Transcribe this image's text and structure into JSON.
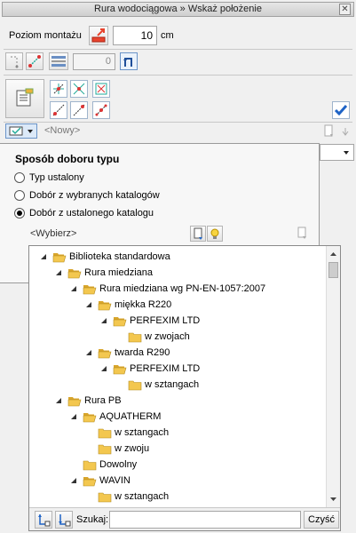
{
  "window": {
    "title": "Rura wodociągowa » Wskaż położenie"
  },
  "mount": {
    "label": "Poziom montażu",
    "value": "10",
    "unit": "cm"
  },
  "row2": {
    "counter": "0"
  },
  "type_row": {
    "placeholder": "<Nowy>"
  },
  "panel": {
    "title": "Sposób doboru typu",
    "options": [
      {
        "label": "Typ ustalony",
        "selected": false
      },
      {
        "label": "Dobór z wybranych katalogów",
        "selected": false
      },
      {
        "label": "Dobór z ustalonego katalogu",
        "selected": true
      }
    ],
    "catalog_select": "<Wybierz>"
  },
  "tree": {
    "items": [
      {
        "label": "Biblioteka standardowa",
        "level": 0,
        "expanded": true
      },
      {
        "label": "Rura miedziana",
        "level": 1,
        "expanded": true
      },
      {
        "label": "Rura miedziana wg PN-EN-1057:2007",
        "level": 2,
        "expanded": true
      },
      {
        "label": "miękka R220",
        "level": 3,
        "expanded": true
      },
      {
        "label": "PERFEXIM LTD",
        "level": 4,
        "expanded": true
      },
      {
        "label": "w zwojach",
        "level": 5,
        "expanded": false
      },
      {
        "label": "twarda R290",
        "level": 3,
        "expanded": true
      },
      {
        "label": "PERFEXIM LTD",
        "level": 4,
        "expanded": true
      },
      {
        "label": "w sztangach",
        "level": 5,
        "expanded": false
      },
      {
        "label": "Rura PB",
        "level": 1,
        "expanded": true
      },
      {
        "label": "AQUATHERM",
        "level": 2,
        "expanded": true
      },
      {
        "label": "w sztangach",
        "level": 3,
        "expanded": false
      },
      {
        "label": "w zwoju",
        "level": 3,
        "expanded": false
      },
      {
        "label": "Dowolny",
        "level": 2,
        "expanded": false
      },
      {
        "label": "WAVIN",
        "level": 2,
        "expanded": true
      },
      {
        "label": "w sztangach",
        "level": 3,
        "expanded": false
      }
    ]
  },
  "search": {
    "label": "Szukaj:",
    "clear_label": "Czyść"
  },
  "colors": {
    "folder": "#f3c74f",
    "accent": "#2b6fc9"
  }
}
